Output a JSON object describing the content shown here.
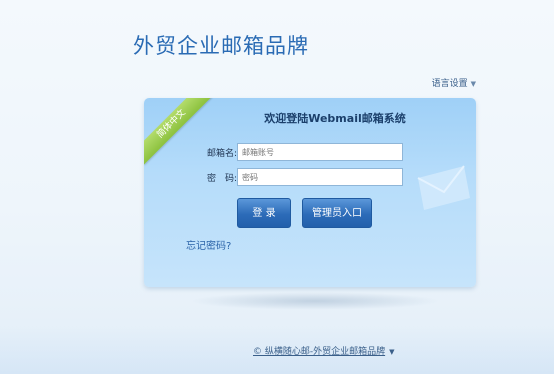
{
  "header": {
    "brand_title": "外贸企业邮箱品牌",
    "language_label": "语言设置"
  },
  "login": {
    "ribbon_label": "简体中文",
    "title": "欢迎登陆Webmail邮箱系统",
    "account_label": "邮箱名:",
    "account_placeholder": "邮箱账号",
    "password_label": "密　码:",
    "password_placeholder": "密码",
    "login_button": "登 录",
    "admin_button": "管理员入口",
    "forgot_link": "忘记密码?"
  },
  "footer": {
    "watermark_text": "© 纵横随心邮-外贸企业邮箱品牌"
  },
  "icons": {
    "caret": "chevron-down-icon",
    "envelope": "envelope-icon"
  },
  "colors": {
    "brand": "#2a6bb4",
    "panel": "#b5dcfa",
    "ribbon": "#8cc13e",
    "button": "#2c6bb8"
  }
}
